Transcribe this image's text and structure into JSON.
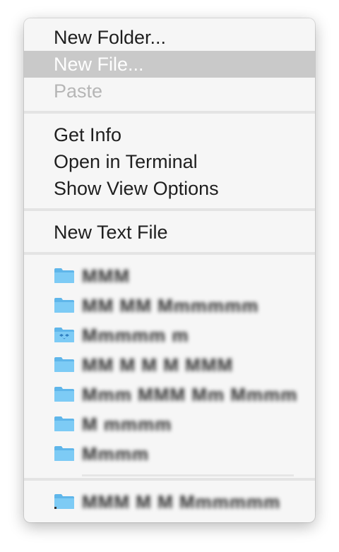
{
  "menu": {
    "group1": [
      {
        "label": "New Folder...",
        "state": "normal"
      },
      {
        "label": "New File...",
        "state": "highlighted"
      },
      {
        "label": "Paste",
        "state": "disabled"
      }
    ],
    "group2": [
      {
        "label": "Get Info"
      },
      {
        "label": "Open in Terminal"
      },
      {
        "label": "Show View Options"
      }
    ],
    "group3": [
      {
        "label": "New Text File"
      }
    ],
    "recent_folders": [
      {
        "label": "MMM",
        "icon": "folder-icon"
      },
      {
        "label": "MM MM Mmmmmm",
        "icon": "folder-icon"
      },
      {
        "label": "Mmmmm m",
        "icon": "dropbox-folder-icon"
      },
      {
        "label": "MM M M M MMM",
        "icon": "folder-icon"
      },
      {
        "label": "Mmm MMM Mm Mmmm",
        "icon": "folder-icon"
      },
      {
        "label": "M mmmm",
        "icon": "folder-icon"
      },
      {
        "label": "Mmmm",
        "icon": "folder-icon"
      }
    ],
    "pinned_folder": {
      "label": "MMM M M Mmmmmm",
      "icon": "folder-icon"
    }
  },
  "colors": {
    "menu_background": "#f6f6f6",
    "highlight": "#c9c9c9",
    "folder_blue": "#6cc1f0",
    "disabled_text": "#b6b6b6"
  }
}
